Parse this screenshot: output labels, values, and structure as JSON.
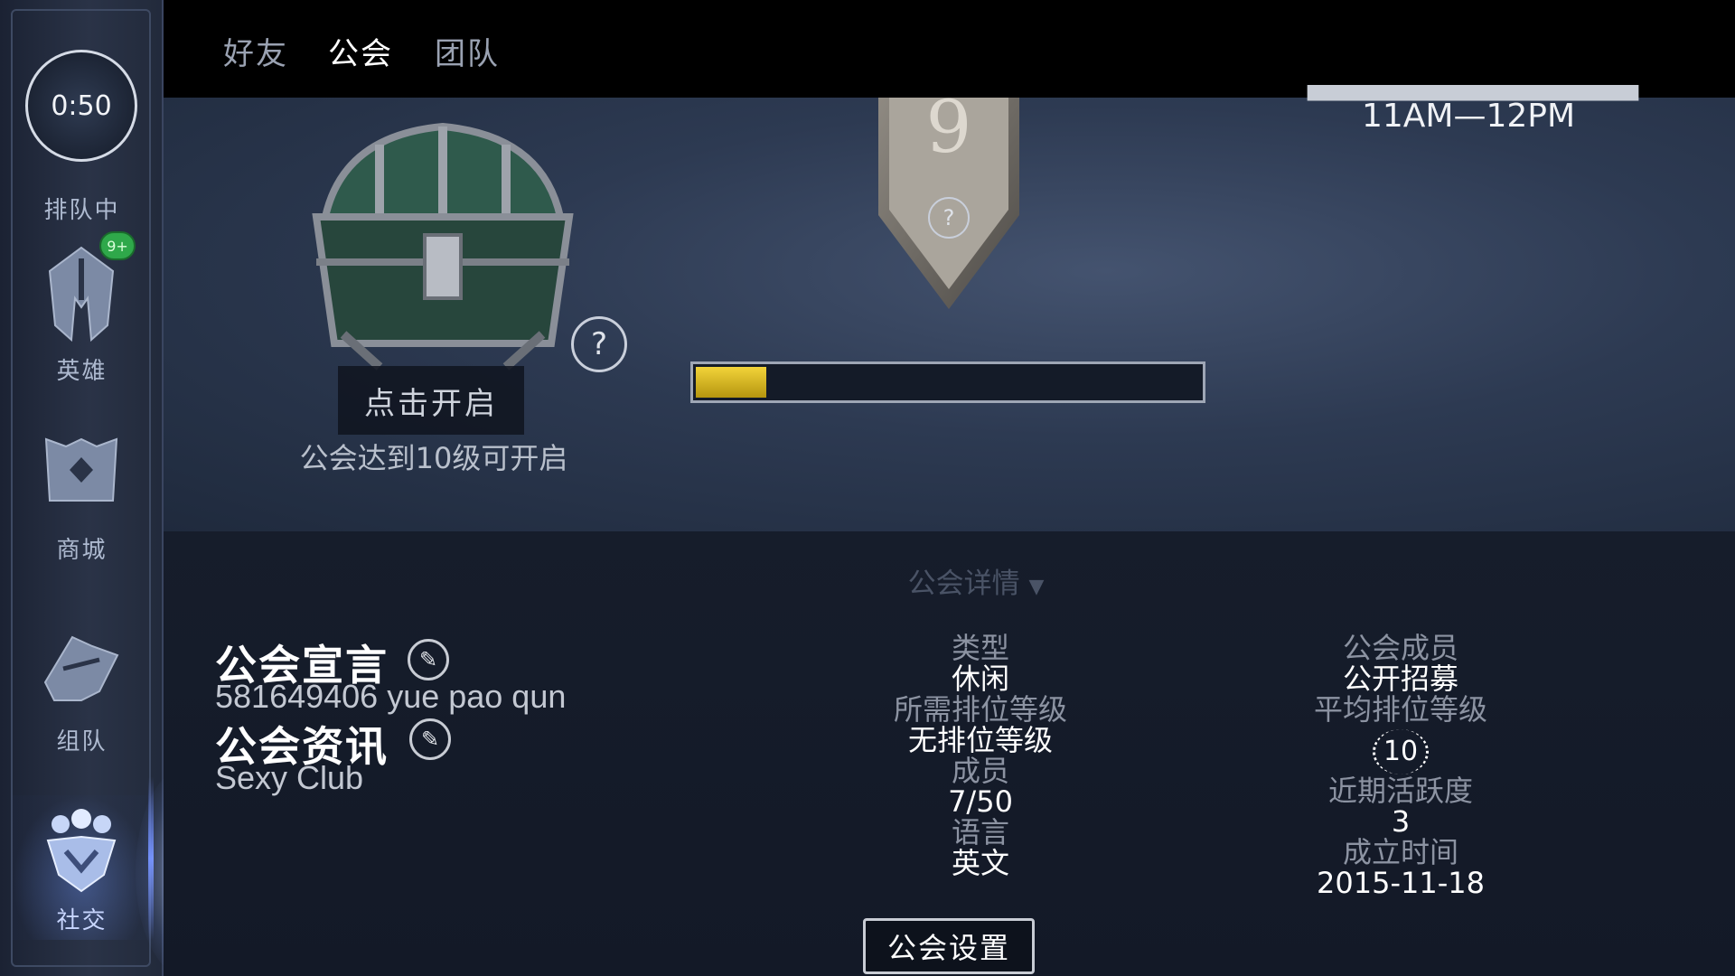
{
  "sidebar": {
    "queue": {
      "timer": "0:50",
      "label": "排队中"
    },
    "items": [
      {
        "label": "英雄",
        "badge": "9+"
      },
      {
        "label": "商城"
      },
      {
        "label": "组队"
      },
      {
        "label": "社交"
      }
    ]
  },
  "tabs": [
    "好友",
    "公会",
    "团队"
  ],
  "chest": {
    "button": "点击开启",
    "hint": "公会达到10级可开启",
    "help": "?"
  },
  "guild_level": {
    "value": "9",
    "help": "?",
    "progress": 0.14
  },
  "activity_window": {
    "time": "11AM—12PM"
  },
  "details": {
    "toggle": "公会详情",
    "declaration_title": "公会宣言",
    "declaration_text": "581649406 yue pao qun",
    "news_title": "公会资讯",
    "news_text": "Sexy Club",
    "col1": [
      {
        "label": "类型",
        "value": "休闲"
      },
      {
        "label": "所需排位等级",
        "value": "无排位等级"
      },
      {
        "label": "成员",
        "value": "7/50"
      },
      {
        "label": "语言",
        "value": "英文"
      }
    ],
    "col2": {
      "members_label": "公会成员",
      "members_value": "公开招募",
      "avg_rank_label": "平均排位等级",
      "avg_rank_value": "10",
      "activity_label": "近期活跃度",
      "activity_value": "3",
      "founded_label": "成立时间",
      "founded_value": "2015-11-18"
    },
    "settings_button": "公会设置"
  },
  "colors": {
    "progress": "#f2d33a",
    "badge": "#2fa84a",
    "accent_glow": "#6f8dff"
  }
}
